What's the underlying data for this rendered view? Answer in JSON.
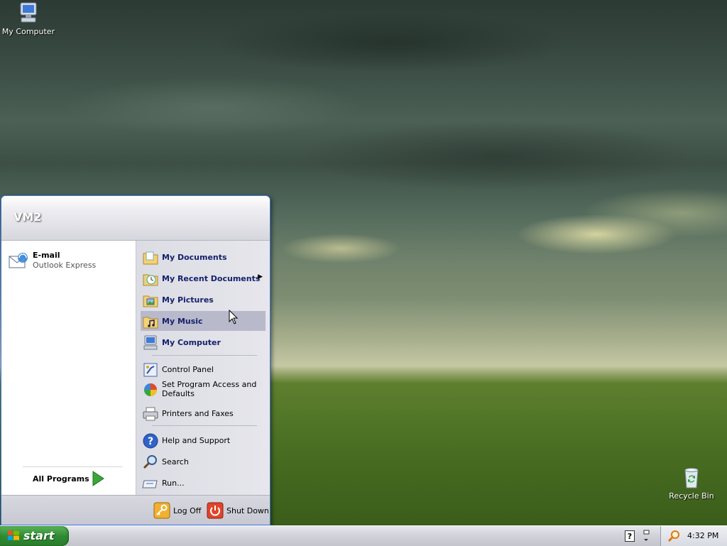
{
  "desktop": {
    "icons": [
      {
        "label": "My Computer",
        "icon": "my-computer-icon"
      },
      {
        "label": "Recycle Bin",
        "icon": "recycle-bin-icon"
      }
    ]
  },
  "start_menu": {
    "username": "VM2",
    "pinned": {
      "email": {
        "title": "E-mail",
        "subtitle": "Outlook Express",
        "icon": "outlook-express-icon"
      }
    },
    "all_programs_label": "All Programs",
    "right_items": [
      {
        "label": "My Documents",
        "icon": "folder-documents-icon"
      },
      {
        "label": "My Recent Documents",
        "icon": "recent-documents-icon",
        "submenu": true
      },
      {
        "label": "My Pictures",
        "icon": "folder-pictures-icon"
      },
      {
        "label": "My Music",
        "icon": "folder-music-icon",
        "highlighted": true
      },
      {
        "label": "My Computer",
        "icon": "my-computer-icon"
      },
      {
        "label": "Control Panel",
        "icon": "control-panel-icon"
      },
      {
        "label": "Set Program Access and Defaults",
        "icon": "program-defaults-icon"
      },
      {
        "label": "Printers and Faxes",
        "icon": "printer-icon"
      },
      {
        "label": "Help and Support",
        "icon": "help-icon"
      },
      {
        "label": "Search",
        "icon": "search-icon"
      },
      {
        "label": "Run...",
        "icon": "run-icon"
      }
    ],
    "footer": {
      "log_off_label": "Log Off",
      "shut_down_label": "Shut Down"
    }
  },
  "taskbar": {
    "start_label": "start",
    "clock": "4:32 PM"
  },
  "colors": {
    "start_button": "#2f8a32",
    "menu_border": "#3a72d6",
    "highlight": "#b9b9cc"
  }
}
